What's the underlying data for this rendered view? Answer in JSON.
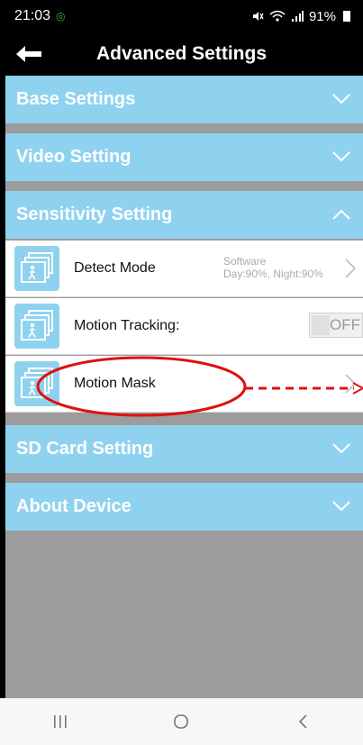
{
  "status_bar": {
    "time": "21:03",
    "battery": "91%"
  },
  "header": {
    "title": "Advanced Settings"
  },
  "sections": {
    "base": "Base Settings",
    "video": "Video Setting",
    "sensitivity": "Sensitivity Setting",
    "sd": "SD Card Setting",
    "about": "About Device"
  },
  "rows": {
    "detect_mode": {
      "label": "Detect Mode",
      "value_line1": "Software",
      "value_line2": "Day:90%, Night:90%"
    },
    "motion_tracking": {
      "label": "Motion Tracking:",
      "toggle": "OFF"
    },
    "motion_mask": {
      "label": "Motion Mask"
    }
  },
  "colors": {
    "section_bg": "#8fd2f0",
    "annotation": "#e01010"
  }
}
